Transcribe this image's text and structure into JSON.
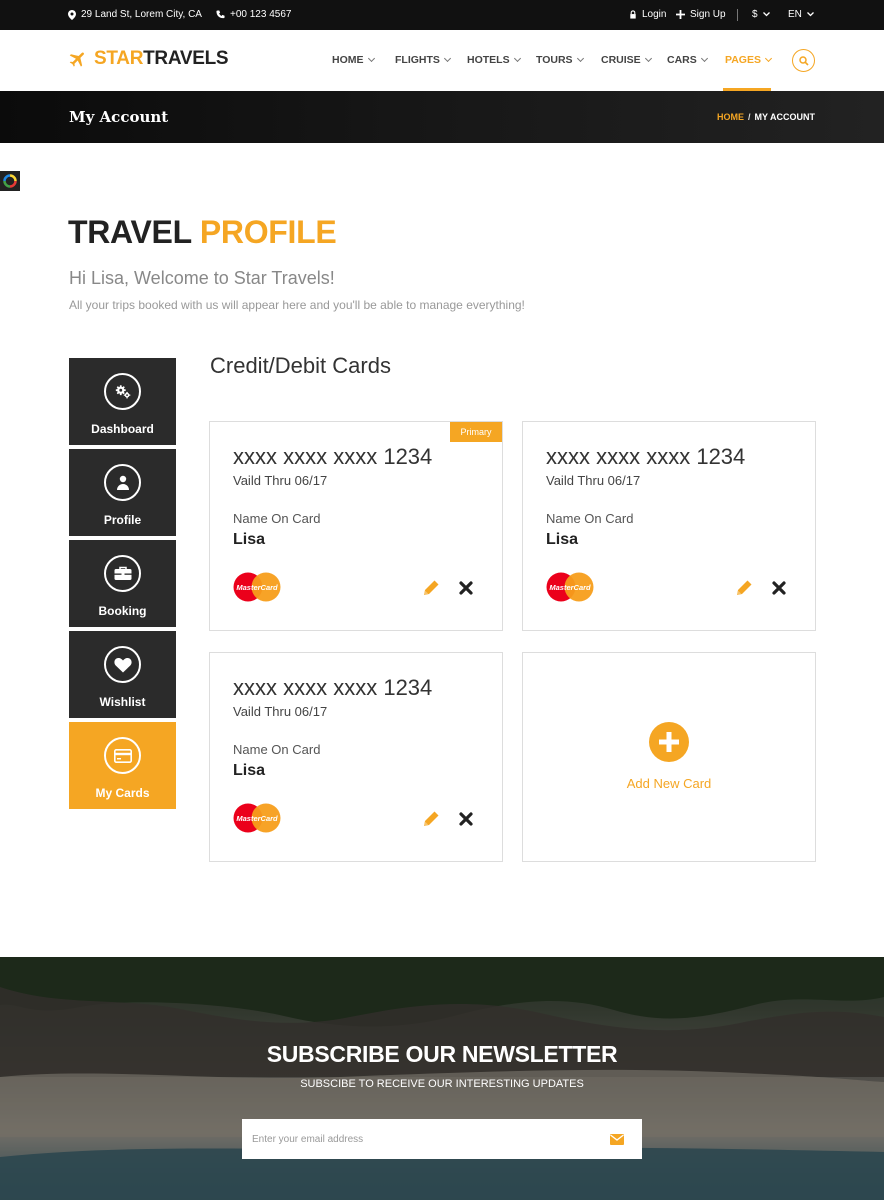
{
  "topbar": {
    "address": "29 Land St, Lorem City, CA",
    "phone": "+00 123 4567",
    "login": "Login",
    "signup": "Sign Up",
    "currency": "$",
    "language": "EN"
  },
  "logo": {
    "part1": "STAR",
    "part2": "TRAVELS"
  },
  "nav": {
    "items": [
      "HOME",
      "FLIGHTS",
      "HOTELS",
      "TOURS",
      "CRUISE",
      "CARS",
      "PAGES"
    ],
    "active": "PAGES"
  },
  "banner": {
    "title": "My Account",
    "breadcrumb_home": "HOME",
    "breadcrumb_current": "MY ACCOUNT"
  },
  "profile": {
    "title_part1": "TRAVEL",
    "title_part2": "PROFILE",
    "welcome": "Hi Lisa, Welcome to Star Travels!",
    "subtitle": "All your trips booked with us will appear here and you'll be able to manage everything!"
  },
  "sidebar": {
    "items": [
      {
        "label": "Dashboard",
        "icon": "gears-icon"
      },
      {
        "label": "Profile",
        "icon": "user-icon"
      },
      {
        "label": "Booking",
        "icon": "briefcase-icon"
      },
      {
        "label": "Wishlist",
        "icon": "heart-icon"
      },
      {
        "label": "My Cards",
        "icon": "credit-card-icon"
      }
    ],
    "active": "My Cards"
  },
  "cards_section": {
    "title": "Credit/Debit Cards",
    "primary_label": "Primary",
    "name_label": "Name On Card",
    "brand_label": "MasterCard",
    "cards": [
      {
        "number": "xxxx xxxx xxxx 1234",
        "valid": "Vaild Thru 06/17",
        "name": "Lisa"
      },
      {
        "number": "xxxx xxxx xxxx 1234",
        "valid": "Vaild Thru 06/17",
        "name": "Lisa"
      },
      {
        "number": "xxxx xxxx xxxx 1234",
        "valid": "Vaild Thru 06/17",
        "name": "Lisa"
      }
    ],
    "add_label": "Add New Card"
  },
  "newsletter": {
    "title": "SUBSCRIBE OUR NEWSLETTER",
    "subtitle": "SUBSCIBE TO RECEIVE OUR INTERESTING UPDATES",
    "placeholder": "Enter your email address"
  },
  "colors": {
    "accent": "#f5a623",
    "dark": "#2b2b2b",
    "topbar": "#111111"
  }
}
